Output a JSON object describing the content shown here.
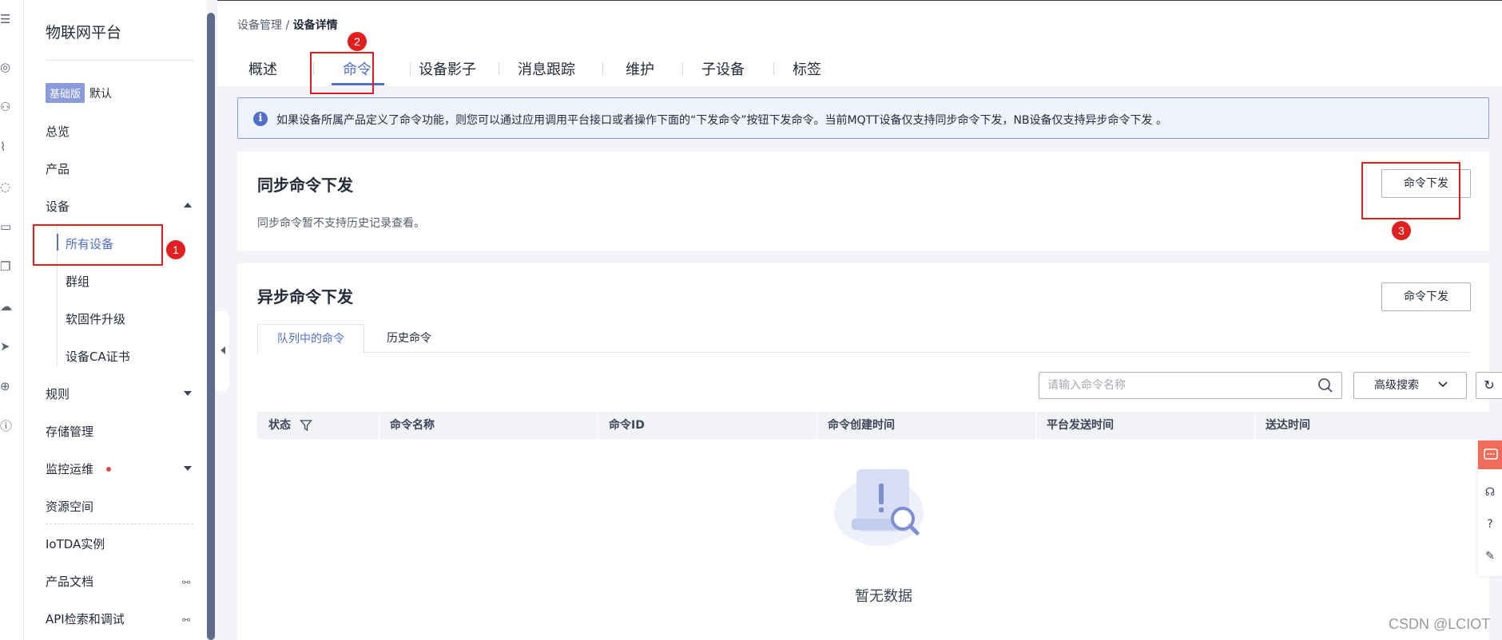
{
  "rail_icons": [
    "menu-icon",
    "globe-chat-icon",
    "nodes-icon",
    "chart-icon",
    "cloud-chat-icon",
    "document-icon",
    "pages-icon",
    "cloud-icon",
    "arrow-icon",
    "world-icon",
    "help-circle-icon"
  ],
  "sidebar": {
    "title": "物联网平台",
    "edition_badge": "基础版",
    "edition_name": "默认",
    "items": {
      "overview": "总览",
      "product": "产品",
      "device": "设备",
      "rules": "规则",
      "storage": "存储管理",
      "monitor": "监控运维",
      "resource": "资源空间",
      "iotda": "IoTDA实例",
      "docs": "产品文档",
      "api": "API检索和调试"
    },
    "device_sub": [
      "所有设备",
      "群组",
      "软固件升级",
      "设备CA证书"
    ]
  },
  "breadcrumb": {
    "parent": "设备管理",
    "separator": " / ",
    "current": "设备详情"
  },
  "tabs": [
    "概述",
    "命令",
    "设备影子",
    "消息跟踪",
    "维护",
    "子设备",
    "标签"
  ],
  "active_tab": "命令",
  "notice": "如果设备所属产品定义了命令功能，则您可以通过应用调用平台接口或者操作下面的“下发命令”按钮下发命令。当前MQTT设备仅支持同步命令下发，NB设备仅支持异步命令下发 。",
  "sync": {
    "title": "同步命令下发",
    "desc": "同步命令暂不支持历史记录查看。",
    "button": "命令下发"
  },
  "async": {
    "title": "异步命令下发",
    "button": "命令下发",
    "subtabs": [
      "队列中的命令",
      "历史命令"
    ],
    "search_placeholder": "请输入命令名称",
    "adv_search": "高级搜索",
    "columns": [
      "状态",
      "命令名称",
      "命令ID",
      "命令创建时间",
      "平台发送时间",
      "送达时间"
    ],
    "empty": "暂无数据"
  },
  "annotations": [
    "1",
    "2",
    "3"
  ],
  "watermark": "CSDN @LCIOT",
  "colors": {
    "accent": "#526ecc",
    "annotation": "#e02020",
    "badge": "#8a9bdc",
    "chat": "#ef6c5a"
  }
}
